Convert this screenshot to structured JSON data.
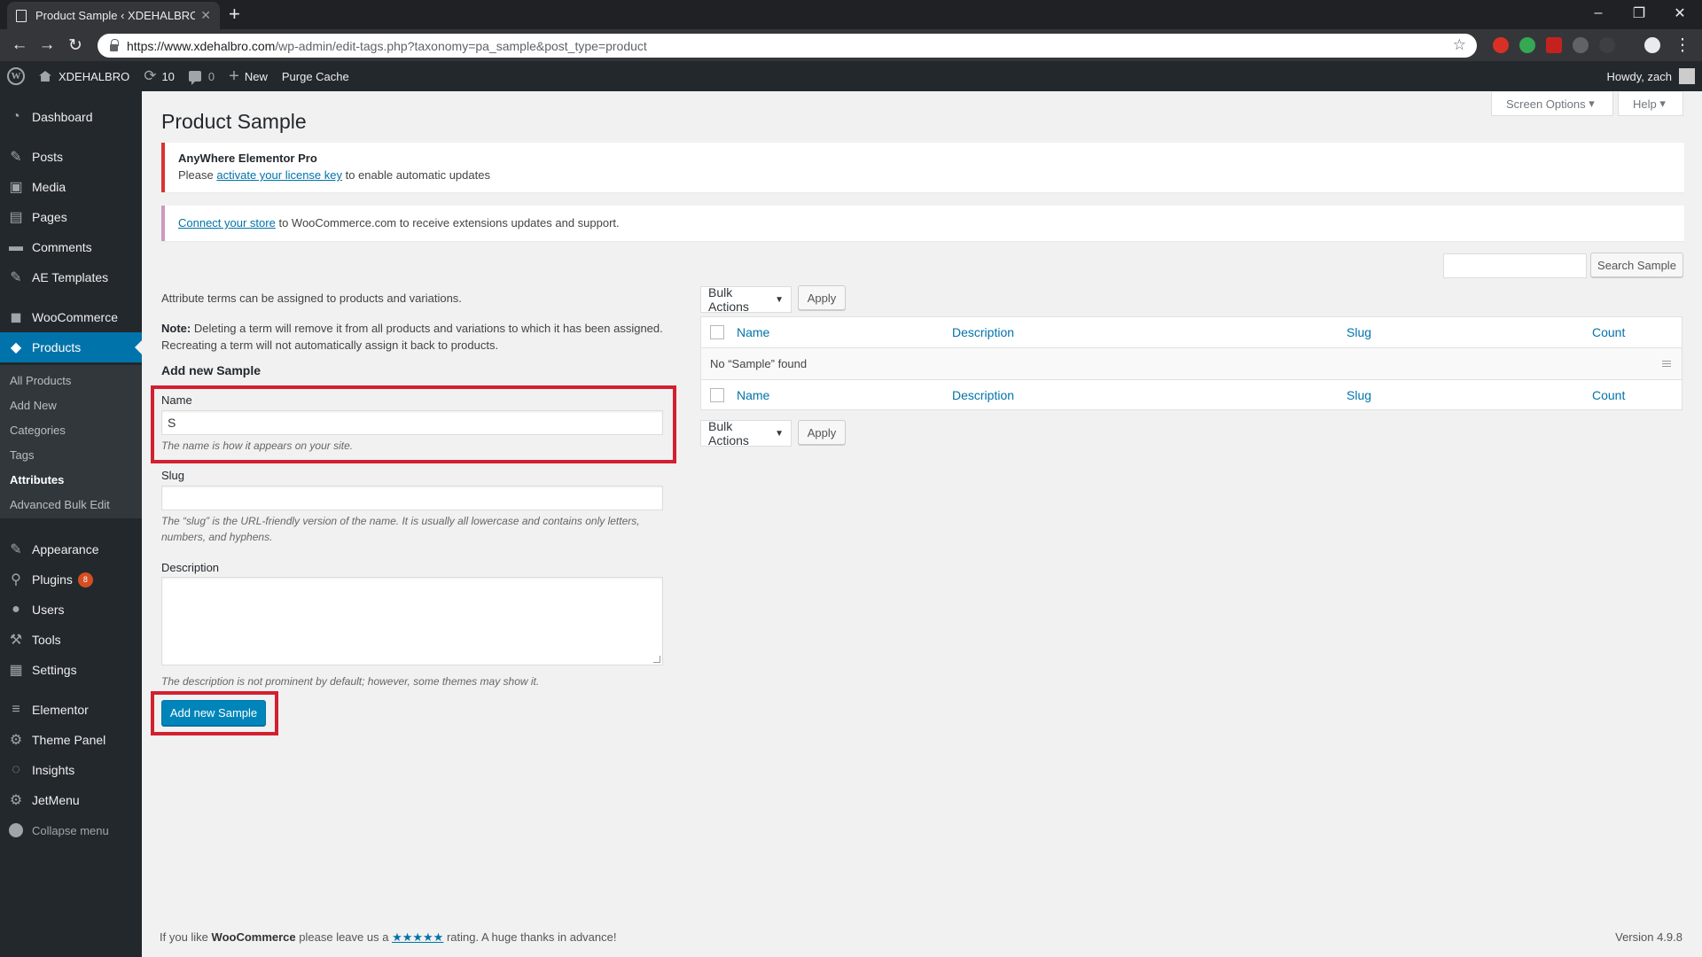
{
  "browser": {
    "tab_title": "Product Sample ‹ XDEHALBRO —",
    "url_host": "https://www.xdehalbro.com",
    "url_path": "/wp-admin/edit-tags.php?taxonomy=pa_sample&post_type=product"
  },
  "adminbar": {
    "site_name": "XDEHALBRO",
    "updates_count": "10",
    "comments_count": "0",
    "new_label": "New",
    "purge_label": "Purge Cache",
    "howdy": "Howdy, zach"
  },
  "sidebar": {
    "items": [
      {
        "label": "Dashboard",
        "icon": "dashboard-icon"
      },
      {
        "label": "Posts",
        "icon": "pin-icon"
      },
      {
        "label": "Media",
        "icon": "media-icon"
      },
      {
        "label": "Pages",
        "icon": "pages-icon"
      },
      {
        "label": "Comments",
        "icon": "comment-icon"
      },
      {
        "label": "AE Templates",
        "icon": "pin-icon"
      },
      {
        "label": "WooCommerce",
        "icon": "woo-icon"
      },
      {
        "label": "Products",
        "icon": "products-icon"
      },
      {
        "label": "Appearance",
        "icon": "brush-icon"
      },
      {
        "label": "Plugins",
        "icon": "plugin-icon",
        "badge": "8"
      },
      {
        "label": "Users",
        "icon": "user-icon"
      },
      {
        "label": "Tools",
        "icon": "wrench-icon"
      },
      {
        "label": "Settings",
        "icon": "settings-icon"
      },
      {
        "label": "Elementor",
        "icon": "elementor-icon"
      },
      {
        "label": "Theme Panel",
        "icon": "gear-icon"
      },
      {
        "label": "Insights",
        "icon": "insights-icon"
      },
      {
        "label": "JetMenu",
        "icon": "gear-icon"
      }
    ],
    "submenu": [
      "All Products",
      "Add New",
      "Categories",
      "Tags",
      "Attributes",
      "Advanced Bulk Edit"
    ],
    "collapse_label": "Collapse menu"
  },
  "page": {
    "title": "Product Sample",
    "screen_options": "Screen Options",
    "help": "Help"
  },
  "notices": {
    "elementor_title": "AnyWhere Elementor Pro",
    "elementor_pre": "Please ",
    "elementor_link": "activate your license key",
    "elementor_post": " to enable automatic updates",
    "woo_link": "Connect your store",
    "woo_post": " to WooCommerce.com to receive extensions updates and support."
  },
  "search": {
    "button": "Search Sample",
    "value": ""
  },
  "form": {
    "intro": "Attribute terms can be assigned to products and variations.",
    "note_label": "Note:",
    "note_line1": " Deleting a term will remove it from all products and variations to which it has been assigned.",
    "note_line2": "Recreating a term will not automatically assign it back to products.",
    "heading": "Add new Sample",
    "name_label": "Name",
    "name_value": "S",
    "name_desc": "The name is how it appears on your site.",
    "slug_label": "Slug",
    "slug_value": "",
    "slug_desc1": "The “slug” is the URL-friendly version of the name. It is usually all lowercase and contains only letters,",
    "slug_desc2": "numbers, and hyphens.",
    "desc_label": "Description",
    "desc_help": "The description is not prominent by default; however, some themes may show it.",
    "submit": "Add new Sample"
  },
  "table": {
    "bulk_actions": "Bulk Actions",
    "apply": "Apply",
    "columns": [
      "Name",
      "Description",
      "Slug",
      "Count"
    ],
    "empty": "No “Sample” found"
  },
  "footer": {
    "pre": "If you like ",
    "brand": "WooCommerce",
    "mid": " please leave us a ",
    "stars": "★★★★★",
    "post": " rating. A huge thanks in advance!",
    "version": "Version 4.9.8"
  },
  "colors": {
    "accent": "#0073aa",
    "highlight": "#d32030",
    "sidebar": "#23282d"
  }
}
